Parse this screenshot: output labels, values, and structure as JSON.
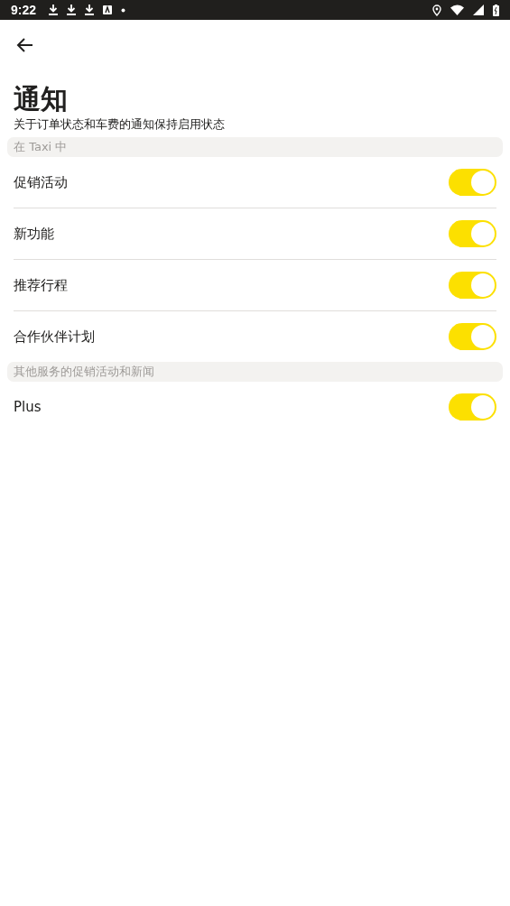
{
  "status_bar": {
    "time": "9:22"
  },
  "title": "通知",
  "subtitle": "关于订单状态和车费的通知保持启用状态",
  "sections": [
    {
      "header": "在 Taxi 中",
      "items": [
        {
          "label": "促销活动",
          "on": true
        },
        {
          "label": "新功能",
          "on": true
        },
        {
          "label": "推荐行程",
          "on": true
        },
        {
          "label": "合作伙伴计划",
          "on": true
        }
      ]
    },
    {
      "header": "其他服务的促销活动和新闻",
      "items": [
        {
          "label": "Plus",
          "on": true
        }
      ]
    }
  ]
}
